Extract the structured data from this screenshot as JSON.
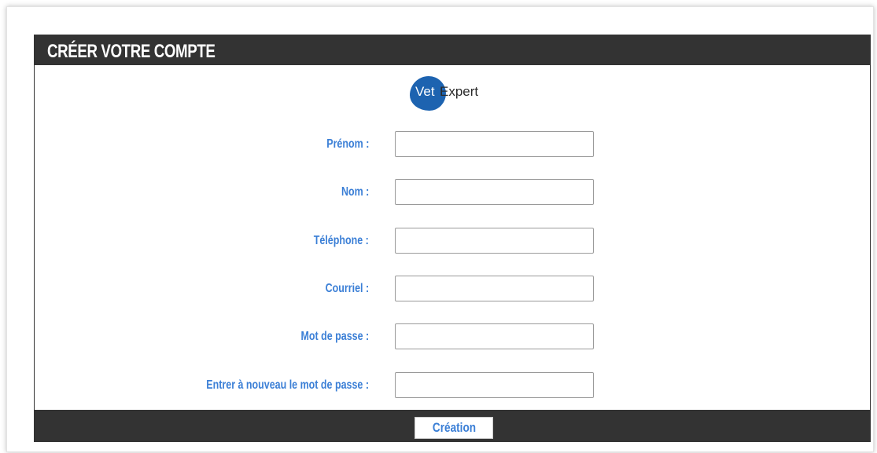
{
  "header": {
    "title": "CRÉER VOTRE COMPTE"
  },
  "logo": {
    "part1": "Vet",
    "part2": "Expert"
  },
  "form": {
    "fields": [
      {
        "label": "Prénom :",
        "value": "",
        "placeholder": ""
      },
      {
        "label": "Nom :",
        "value": "",
        "placeholder": ""
      },
      {
        "label": "Téléphone :",
        "value": "",
        "placeholder": ""
      },
      {
        "label": "Courriel :",
        "value": "",
        "placeholder": ""
      },
      {
        "label": "Mot de passe :",
        "value": "",
        "placeholder": ""
      },
      {
        "label": "Entrer à nouveau le mot de passe :",
        "value": "",
        "placeholder": ""
      }
    ]
  },
  "footer": {
    "submit_label": "Création"
  },
  "colors": {
    "header_background": "#333333",
    "label_text": "#3b7fd6",
    "logo_blue": "#1d63b0"
  }
}
